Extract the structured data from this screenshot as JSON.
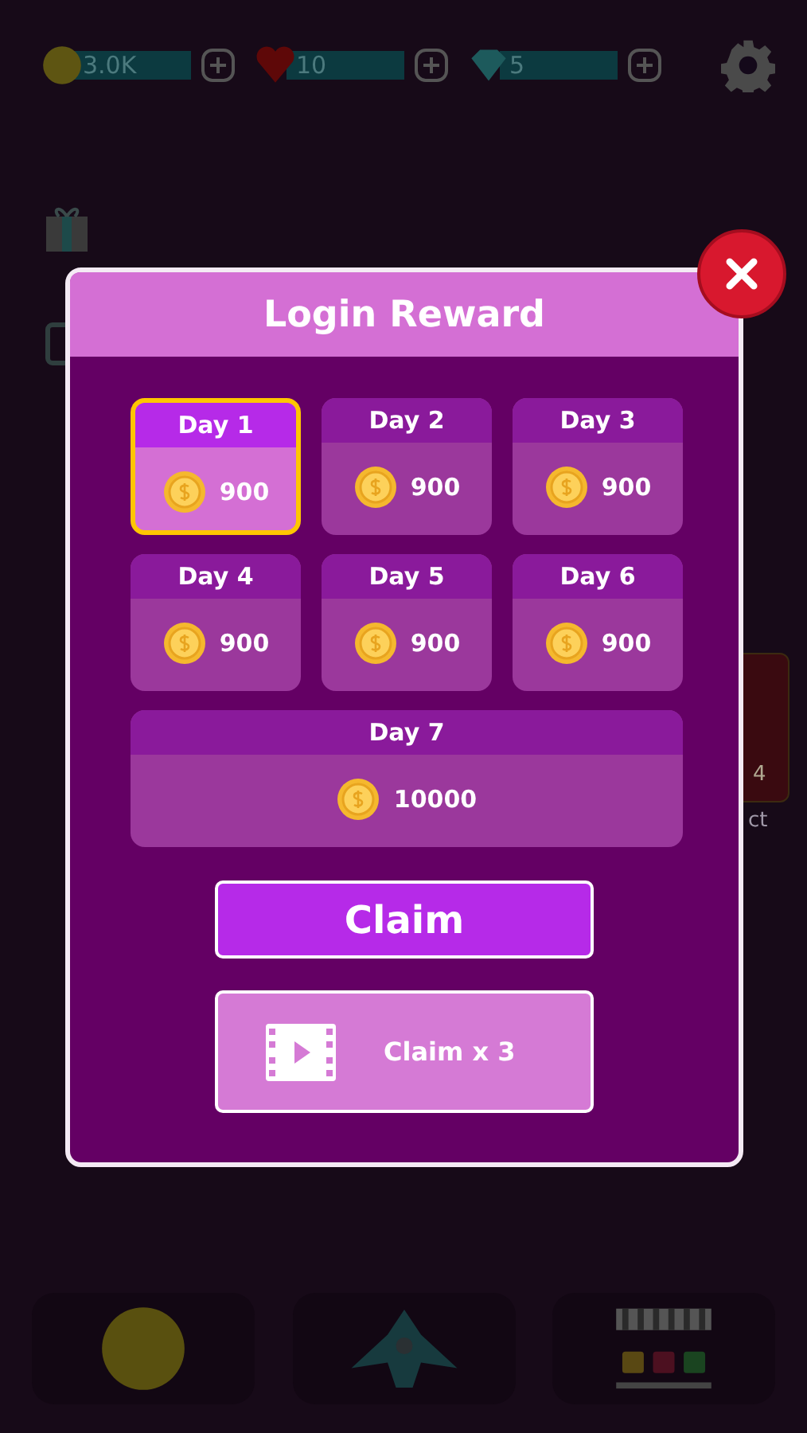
{
  "top_bar": {
    "currencies": [
      {
        "kind": "coin",
        "value": "3.0K"
      },
      {
        "kind": "heart",
        "value": "10"
      },
      {
        "kind": "gem",
        "value": "5"
      }
    ]
  },
  "side_offer": {
    "badge": "4",
    "label": "ct"
  },
  "dialog": {
    "title": "Login Reward",
    "days": [
      {
        "label": "Day 1",
        "amount": "900",
        "selected": true
      },
      {
        "label": "Day 2",
        "amount": "900",
        "selected": false
      },
      {
        "label": "Day 3",
        "amount": "900",
        "selected": false
      },
      {
        "label": "Day 4",
        "amount": "900",
        "selected": false
      },
      {
        "label": "Day 5",
        "amount": "900",
        "selected": false
      },
      {
        "label": "Day 6",
        "amount": "900",
        "selected": false
      }
    ],
    "bonus_day": {
      "label": "Day 7",
      "amount": "10000",
      "selected": false
    },
    "buttons": [
      {
        "kind": "primary",
        "label": "Claim"
      },
      {
        "kind": "video",
        "label": "Claim x 3"
      }
    ]
  },
  "bottom_nav": [
    {
      "kind": "coin"
    },
    {
      "kind": "ship"
    },
    {
      "kind": "shop"
    }
  ]
}
